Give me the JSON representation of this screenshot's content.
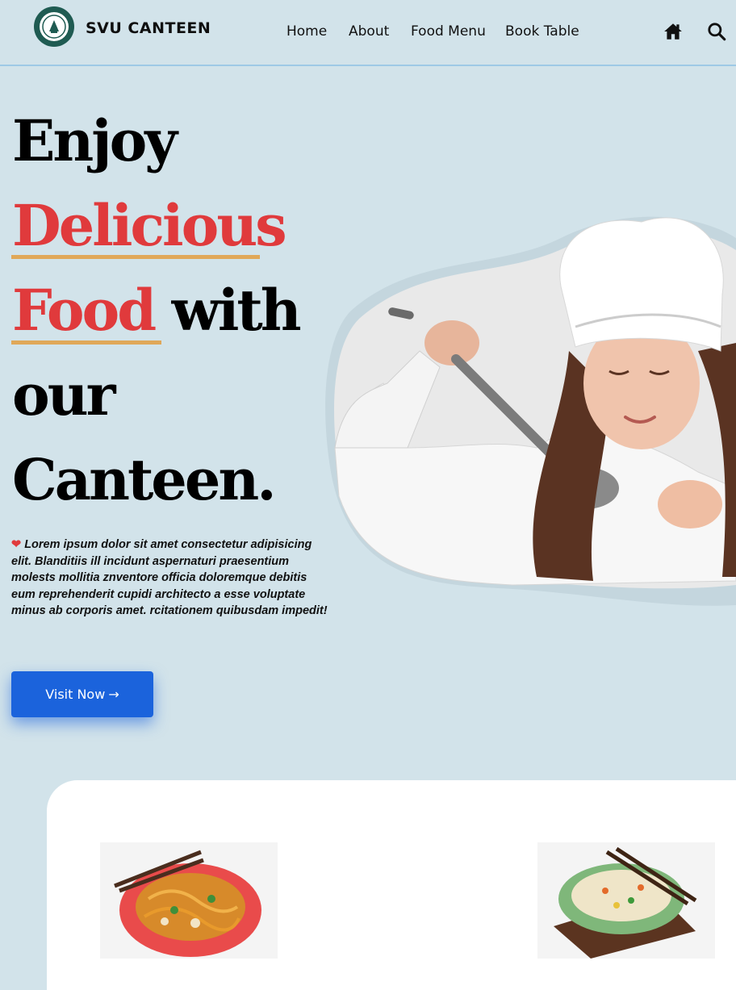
{
  "nav": {
    "brand": "SVU CANTEEN",
    "links": [
      "Home",
      "About",
      "Food Menu",
      "Book Table"
    ],
    "icons": [
      "home-icon",
      "search-icon"
    ]
  },
  "hero": {
    "headline": {
      "line1": "Enjoy",
      "line2": "Delicious",
      "line3_red": "Food",
      "line3_rest": " with",
      "line4": "our",
      "line5": "Canteen."
    },
    "intro": "Lorem ipsum dolor sit amet consectetur adipisicing elit. Blanditiis ill incidunt aspernaturi praesentium molests mollitia znventore officia doloremque debitis eum reprehenderit cupidi architecto a esse voluptate minus ab corporis amet. rcitationem quibusdam impedit!",
    "cta": "Visit Now",
    "cta_arrow": "→"
  },
  "colors": {
    "background": "#d2e3ea",
    "accent_red": "#e03a3c",
    "underline": "#e0a859",
    "button": "#1b63dc"
  },
  "menu": {
    "cards": [
      "noodles-dish-image",
      "fried-rice-dish-image"
    ]
  }
}
